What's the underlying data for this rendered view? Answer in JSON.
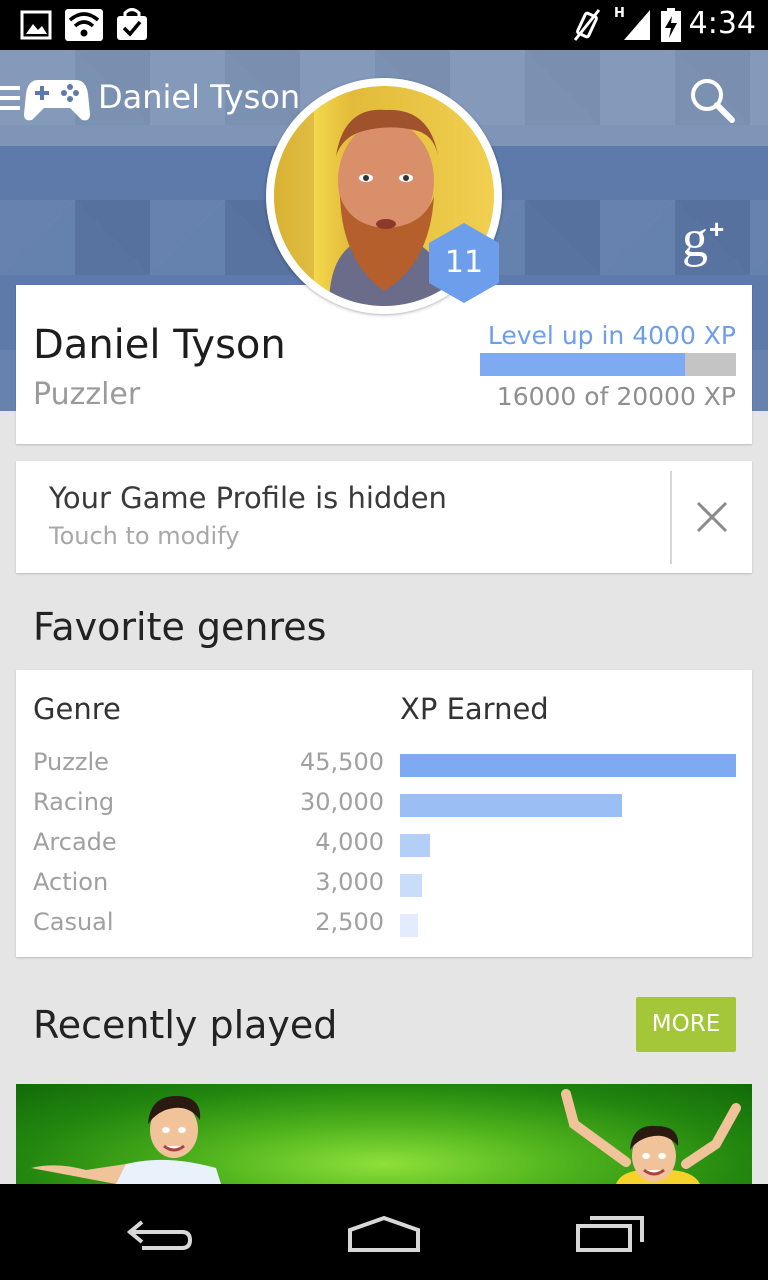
{
  "status_bar": {
    "time": "4:34",
    "network_label": "H"
  },
  "action_bar": {
    "title": "Daniel Tyson"
  },
  "profile": {
    "level": "11",
    "name": "Daniel Tyson",
    "title": "Puzzler",
    "level_up_text": "Level up in 4000 XP",
    "xp_text": "16000 of 20000 XP",
    "xp_current": 16000,
    "xp_total": 20000
  },
  "hidden_notice": {
    "title": "Your Game Profile is hidden",
    "subtitle": "Touch to modify"
  },
  "favorite_genres": {
    "section_title": "Favorite genres",
    "col_genre": "Genre",
    "col_xp": "XP Earned",
    "rows": [
      {
        "name": "Puzzle",
        "xp_label": "45,500",
        "xp": 45500,
        "color": "#7daaf0"
      },
      {
        "name": "Racing",
        "xp_label": "30,000",
        "xp": 30000,
        "color": "#9bbef4"
      },
      {
        "name": "Arcade",
        "xp_label": "4,000",
        "xp": 4000,
        "color": "#b4cff7"
      },
      {
        "name": "Action",
        "xp_label": "3,000",
        "xp": 3000,
        "color": "#c9dcfa"
      },
      {
        "name": "Casual",
        "xp_label": "2,500",
        "xp": 2500,
        "color": "#e3ecfc"
      }
    ]
  },
  "recently_played": {
    "section_title": "Recently played",
    "more_label": "MORE"
  },
  "colors": {
    "hero_blue": "#5d7aaa",
    "accent_blue": "#6d9eeb",
    "more_green": "#a4c639"
  }
}
